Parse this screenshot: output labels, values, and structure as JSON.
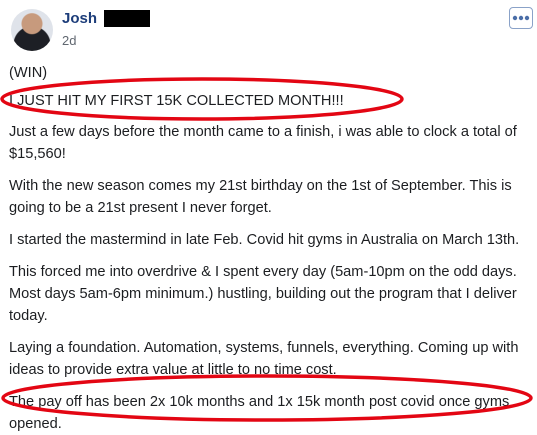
{
  "post": {
    "author": "Josh",
    "time": "2d",
    "paragraphs": [
      "(WIN)",
      "I JUST HIT MY FIRST 15K COLLECTED MONTH!!!",
      "Just a few days before the month came to a finish, i was able to clock a total of $15,560!",
      "With the new season comes my 21st birthday on the 1st of September. This is going to be a 21st present I never forget.",
      "I started the mastermind in late Feb. Covid hit gyms in Australia on March 13th.",
      "This forced me into overdrive & I spent every day (5am-10pm on the odd days. Most days 5am-6pm minimum.) hustling, building out the program that I deliver today.",
      "Laying a foundation. Automation, systems, funnels, everything. Coming up with ideas to provide extra value at little to no time cost.",
      "The pay off has been 2x 10k months and 1x 15k month post covid once gyms opened."
    ]
  },
  "icons": {
    "avatar": "profile-photo",
    "more": "more-options-icon"
  },
  "colors": {
    "author": "#1d3d7a",
    "annotation": "#e30613",
    "meta": "#606770"
  }
}
